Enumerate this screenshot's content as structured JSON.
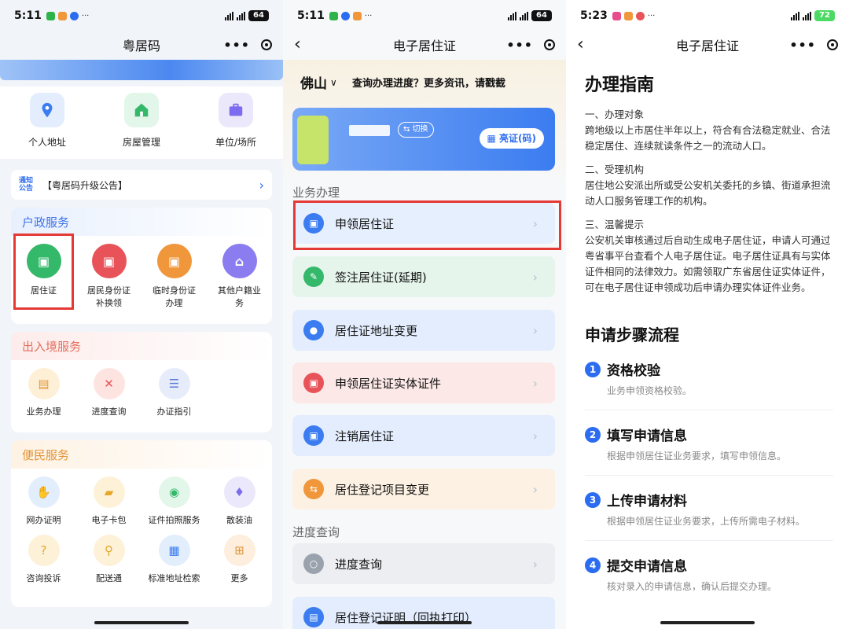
{
  "colors": {
    "primary": "#2c6cf0",
    "highlight_border": "#e53935",
    "household": "#3d73e8",
    "border_service": "#e46e5e",
    "convenience": "#e49436"
  },
  "screen1": {
    "status": {
      "time": "5:11",
      "battery": "64"
    },
    "title": "粤居码",
    "quick_items": [
      {
        "label": "个人地址",
        "icon": "location-pin-icon"
      },
      {
        "label": "房屋管理",
        "icon": "house-icon"
      },
      {
        "label": "单位/场所",
        "icon": "briefcase-icon"
      }
    ],
    "notice": {
      "tag_line1": "通知",
      "tag_line2": "公告",
      "text": "【粤居码升级公告】"
    },
    "household": {
      "title": "户政服务",
      "items": [
        {
          "label": "居住证",
          "label2": "",
          "icon": "id-card-icon",
          "color": "#34b86a"
        },
        {
          "label": "居民身份证",
          "label2": "补换领",
          "icon": "id-card-icon",
          "color": "#e8535a"
        },
        {
          "label": "临时身份证",
          "label2": "办理",
          "icon": "id-card-icon",
          "color": "#f0963b"
        },
        {
          "label": "其他户籍业",
          "label2": "务",
          "icon": "home-user-icon",
          "color": "#8b7cf0"
        }
      ]
    },
    "border": {
      "title": "出入境服务",
      "items": [
        {
          "label": "业务办理",
          "icon": "document-icon",
          "color": "#fdf0d6"
        },
        {
          "label": "进度查询",
          "icon": "cancel-document-icon",
          "color": "#fde4e1"
        },
        {
          "label": "办证指引",
          "icon": "list-icon",
          "color": "#e7ecfb"
        }
      ]
    },
    "convenience": {
      "title": "便民服务",
      "items": [
        {
          "label": "网办证明",
          "icon": "certificate-icon",
          "color": "#e3eefc"
        },
        {
          "label": "电子卡包",
          "icon": "wallet-icon",
          "color": "#fdf1d8"
        },
        {
          "label": "证件拍照服务",
          "icon": "camera-icon",
          "color": "#e2f6ea"
        },
        {
          "label": "散装油",
          "icon": "oil-drop-icon",
          "color": "#ece8fb"
        },
        {
          "label": "咨询投诉",
          "icon": "question-icon",
          "color": "#fdf1d8"
        },
        {
          "label": "配送通",
          "icon": "scooter-icon",
          "color": "#fdf1d8"
        },
        {
          "label": "标准地址检索",
          "icon": "map-icon",
          "color": "#e3eefc"
        },
        {
          "label": "更多",
          "icon": "grid-icon",
          "color": "#fdeedd"
        }
      ]
    }
  },
  "screen2": {
    "status": {
      "time": "5:11",
      "battery": "64"
    },
    "title": "电子居住证",
    "city": "佛山",
    "marquee": "查询办理进度？更多资讯，请戳截",
    "card": {
      "switch_label": "⇆ 切换",
      "show_label": "▦ 亮证(码)"
    },
    "section_business": "业务办理",
    "section_progress": "进度查询",
    "services": [
      {
        "label": "申领居住证",
        "icon": "id-card-icon",
        "color": "#3b7cf0",
        "bg": "#e6effd"
      },
      {
        "label": "签注居住证(延期)",
        "icon": "sign-icon",
        "color": "#34b86a",
        "bg": "#e5f5ec"
      },
      {
        "label": "居住证地址变更",
        "icon": "location-pin-icon",
        "color": "#3b7cf0",
        "bg": "#e3edfd"
      },
      {
        "label": "申领居住证实体证件",
        "icon": "id-card-icon",
        "color": "#e8535a",
        "bg": "#fce9e7"
      },
      {
        "label": "注销居住证",
        "icon": "id-card-icon",
        "color": "#3b7cf0",
        "bg": "#e3edfd"
      },
      {
        "label": "居住登记项目变更",
        "icon": "swap-icon",
        "color": "#f0963b",
        "bg": "#fcf1e2"
      }
    ],
    "progress": [
      {
        "label": "进度查询",
        "icon": "search-icon",
        "color": "#9aa3ad",
        "bg": "#eceef1"
      },
      {
        "label": "居住登记证明（回执打印）",
        "icon": "print-icon",
        "color": "#3b7cf0",
        "bg": "#e3edfd"
      }
    ]
  },
  "screen3": {
    "status": {
      "time": "5:23",
      "battery": "72"
    },
    "title": "电子居住证",
    "guide_title": "办理指南",
    "sections": [
      {
        "title": "一、办理对象",
        "body": "跨地级以上市居住半年以上，符合有合法稳定就业、合法稳定居住、连续就读条件之一的流动人口。"
      },
      {
        "title": "二、受理机构",
        "body": "居住地公安派出所或受公安机关委托的乡镇、街道承担流动人口服务管理工作的机构。"
      },
      {
        "title": "三、温馨提示",
        "body": "公安机关审核通过后自动生成电子居住证，申请人可通过粤省事平台查看个人电子居住证。电子居住证具有与实体证件相同的法律效力。如需领取广东省居住证实体证件，可在电子居住证申领成功后申请办理实体证件业务。"
      }
    ],
    "steps_title": "申请步骤流程",
    "steps": [
      {
        "num": "1",
        "title": "资格校验",
        "desc": "业务申领资格校验。"
      },
      {
        "num": "2",
        "title": "填写申请信息",
        "desc": "根据申领居住证业务要求，填写申领信息。"
      },
      {
        "num": "3",
        "title": "上传申请材料",
        "desc": "根据申领居住证业务要求，上传所需电子材料。"
      },
      {
        "num": "4",
        "title": "提交申请信息",
        "desc": "核对录入的申请信息，确认后提交办理。"
      }
    ]
  }
}
